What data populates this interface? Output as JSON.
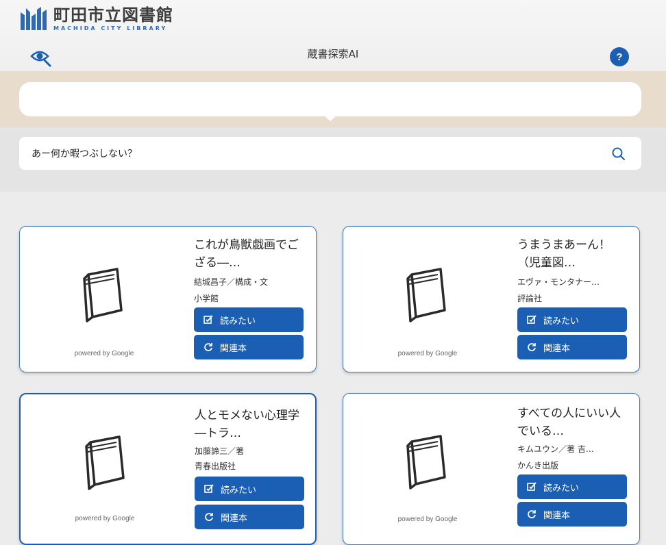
{
  "header": {
    "logo_jp": "町田市立図書館",
    "logo_en": "MACHIDA CITY LIBRARY",
    "app_title": "蔵書探索AI",
    "help_label": "?"
  },
  "search": {
    "value": "あー何か暇つぶしない？"
  },
  "cards": [
    {
      "title": "これが鳥獣戯画でござる―…",
      "author": "結城昌子／構成・文",
      "publisher": "小学館",
      "want_label": "読みたい",
      "related_label": "関連本",
      "powered": "powered by Google"
    },
    {
      "title": "うまうまあーん！（児童図…",
      "author": "エヴァ・モンタナー…",
      "publisher": "評論社",
      "want_label": "読みたい",
      "related_label": "関連本",
      "powered": "powered by Google"
    },
    {
      "title": "人とモメない心理学―トラ…",
      "author": "加藤諦三／著",
      "publisher": "青春出版社",
      "want_label": "読みたい",
      "related_label": "関連本",
      "powered": "powered by Google"
    },
    {
      "title": "すべての人にいい人でいる…",
      "author": "キムユウン／著 吉…",
      "publisher": "かんき出版",
      "want_label": "読みたい",
      "related_label": "関連本",
      "powered": "powered by Google"
    }
  ],
  "colors": {
    "accent": "#1a5fb4",
    "tan": "#e8ddcd",
    "background": "#ececec"
  },
  "icons": [
    "library-logo-icon",
    "eye-search-icon",
    "help-icon",
    "search-icon",
    "book-icon",
    "checkbox-edit-icon",
    "refresh-icon"
  ]
}
